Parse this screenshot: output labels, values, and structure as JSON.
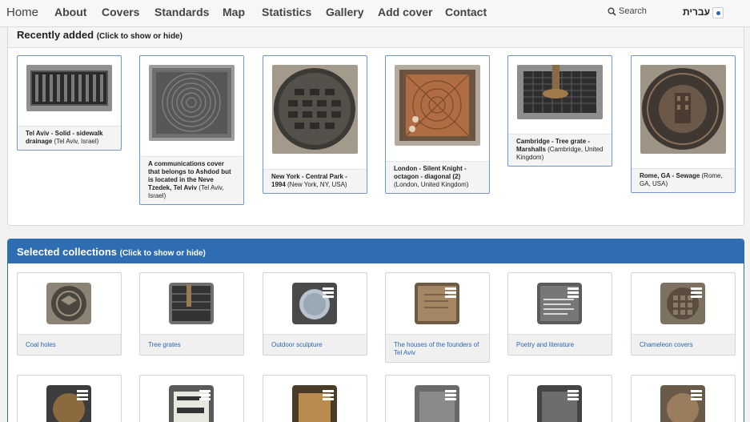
{
  "nav": {
    "home": "Home",
    "items": [
      "About",
      "Covers",
      "Standards",
      "Map",
      "Statistics",
      "Gallery",
      "Add cover",
      "Contact"
    ],
    "search": "Search",
    "language": "עברית"
  },
  "recent": {
    "title": "Recently added",
    "subtitle": "(Click to show or hide)",
    "items": [
      {
        "bold": "Tel Aviv - Solid - sidewalk drainage",
        "rest": " (Tel Aviv, Israel)"
      },
      {
        "bold": "A communications cover that belongs to Ashdod but is located in the Neve Tzedek, Tel Aviv",
        "rest": " (Tel Aviv, Israel)"
      },
      {
        "bold": "New York - Central Park - 1994",
        "rest": " (New York, NY, USA)"
      },
      {
        "bold": "London - Silent Knight - octagon - diagonal (2)",
        "rest": " (London, United Kingdom)"
      },
      {
        "bold": "Cambridge - Tree grate - Marshalls",
        "rest": " (Cambridge, United Kingdom)"
      },
      {
        "bold": "Rome, GA - Sewage",
        "rest": " (Rome, GA, USA)"
      }
    ]
  },
  "collections": {
    "title": "Selected collections",
    "subtitle": "(Click to show or hide)",
    "items": [
      "Coal holes",
      "Tree grates",
      "Outdoor sculpture",
      "The houses of the founders of Tel Aviv",
      "Poetry and literature",
      "Chameleon covers"
    ]
  },
  "colors": {
    "accent": "#2f6db3",
    "link": "#2a66b8",
    "card_border": "#6f96cc"
  },
  "icons": [
    "search-icon",
    "settings-icon",
    "stack-icon"
  ]
}
